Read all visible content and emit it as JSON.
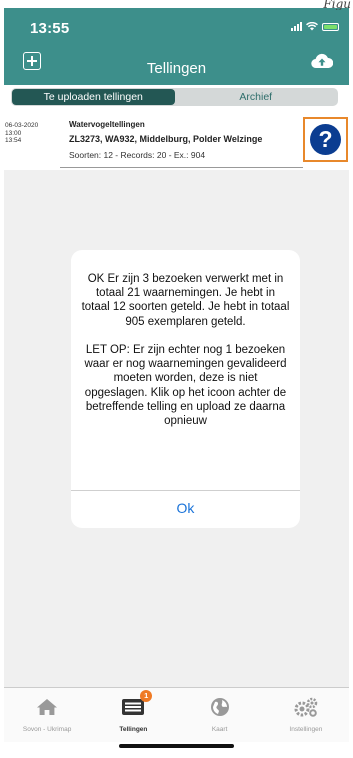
{
  "caption": "Figu",
  "status": {
    "time": "13:55"
  },
  "header": {
    "title": "Tellingen",
    "add_icon": "plus-square-icon",
    "upload_icon": "cloud-upload-icon"
  },
  "segments": {
    "upload": "Te uploaden tellingen",
    "archive": "Archief"
  },
  "row": {
    "date": "06-03-2020",
    "start": "13:00",
    "end": "13:54",
    "type": "Watervogeltellingen",
    "location": "ZL3273, WA932, Middelburg, Polder Welzinge",
    "stats": "Soorten: 12 - Records: 20 - Ex.: 904",
    "help_icon": "question-circle-icon"
  },
  "dialog": {
    "message": "OK Er zijn 3 bezoeken verwerkt met in totaal 21 waarnemingen. Je hebt in totaal 12 soorten geteld. Je hebt in totaal 905 exemplaren geteld.\n\nLET OP: Er zijn echter nog 1 bezoeken waar er nog waarnemingen gevalideerd moeten worden, deze is niet opgeslagen. Klik op het icoon achter de betreffende telling en upload ze daarna opnieuw",
    "ok": "Ok"
  },
  "tabs": [
    {
      "label": "Sovon - Ukrimap",
      "icon": "home-icon"
    },
    {
      "label": "Tellingen",
      "icon": "list-icon",
      "badge": "1"
    },
    {
      "label": "Kaart",
      "icon": "globe-icon"
    },
    {
      "label": "Instellingen",
      "icon": "gears-icon"
    }
  ],
  "colors": {
    "header": "#3d8f8b",
    "segment_active": "#235754",
    "badge": "#ef7a24",
    "link": "#1a73d9",
    "help": "#0b3d91",
    "help_border": "#e8882b"
  }
}
